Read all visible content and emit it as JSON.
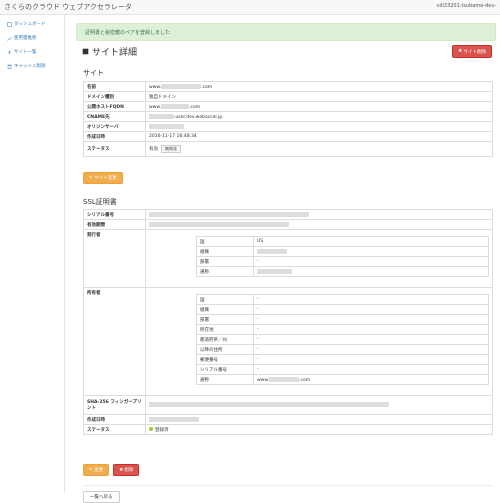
{
  "header": {
    "brand": "さくらのクラウド ウェブアクセラレータ",
    "user": "cdi33201.tsubame-dev-"
  },
  "sidebar": {
    "items": [
      {
        "label": "ダッシュボード",
        "icon": "dashboard-icon"
      },
      {
        "label": "使用量推移",
        "icon": "chart-icon"
      },
      {
        "label": "サイト一覧",
        "icon": "site-icon"
      },
      {
        "label": "キャッシュ削除",
        "icon": "trash-icon"
      }
    ]
  },
  "alert": {
    "text": "証明書と秘密鍵のペアを登録しました"
  },
  "page": {
    "title": "サイト詳細",
    "delete_site": "サイト削除"
  },
  "site": {
    "heading": "サイト",
    "rows": [
      {
        "k": "名前",
        "v": "www.",
        "v2": ".com"
      },
      {
        "k": "ドメイン種別",
        "v": "独自ドメイン"
      },
      {
        "k": "公開ホストFQDN",
        "v": "www.",
        "v2": ".com"
      },
      {
        "k": "CNAME先",
        "v": "",
        "v2": ".user.dev.webaccel.jp."
      },
      {
        "k": "オリジンサーバ",
        "v": ""
      },
      {
        "k": "作成日時",
        "v": "2016-11-17 16:48:34"
      },
      {
        "k": "ステータス",
        "v": "有効",
        "btn": "無効化"
      }
    ],
    "edit_button": "サイト変更"
  },
  "ssl": {
    "heading": "SSL証明書",
    "serial_label": "シリアル番号",
    "validity_label": "有効期間",
    "issuer_label": "発行者",
    "issuer_rows": [
      {
        "k": "国",
        "v": "US"
      },
      {
        "k": "組織",
        "v": ""
      },
      {
        "k": "部署",
        "v": "-"
      },
      {
        "k": "通称",
        "v": ""
      }
    ],
    "owner_label": "所有者",
    "owner_rows": [
      {
        "k": "国",
        "v": "-"
      },
      {
        "k": "組織",
        "v": "-"
      },
      {
        "k": "部署",
        "v": "-"
      },
      {
        "k": "所在地",
        "v": "-"
      },
      {
        "k": "都道府県／州",
        "v": "-"
      },
      {
        "k": "以降の住所",
        "v": "-"
      },
      {
        "k": "郵便番号",
        "v": "-"
      },
      {
        "k": "シリアル番号",
        "v": "-"
      },
      {
        "k": "通称",
        "v": "www.",
        "v2": ".com"
      }
    ],
    "fingerprint_label": "SHA-256 フィンガープリント",
    "created_label": "作成日時",
    "status_label": "ステータス",
    "status_value": "登録済",
    "change_button": "変更",
    "delete_button": "削除"
  },
  "back_button": "一覧へ戻る"
}
